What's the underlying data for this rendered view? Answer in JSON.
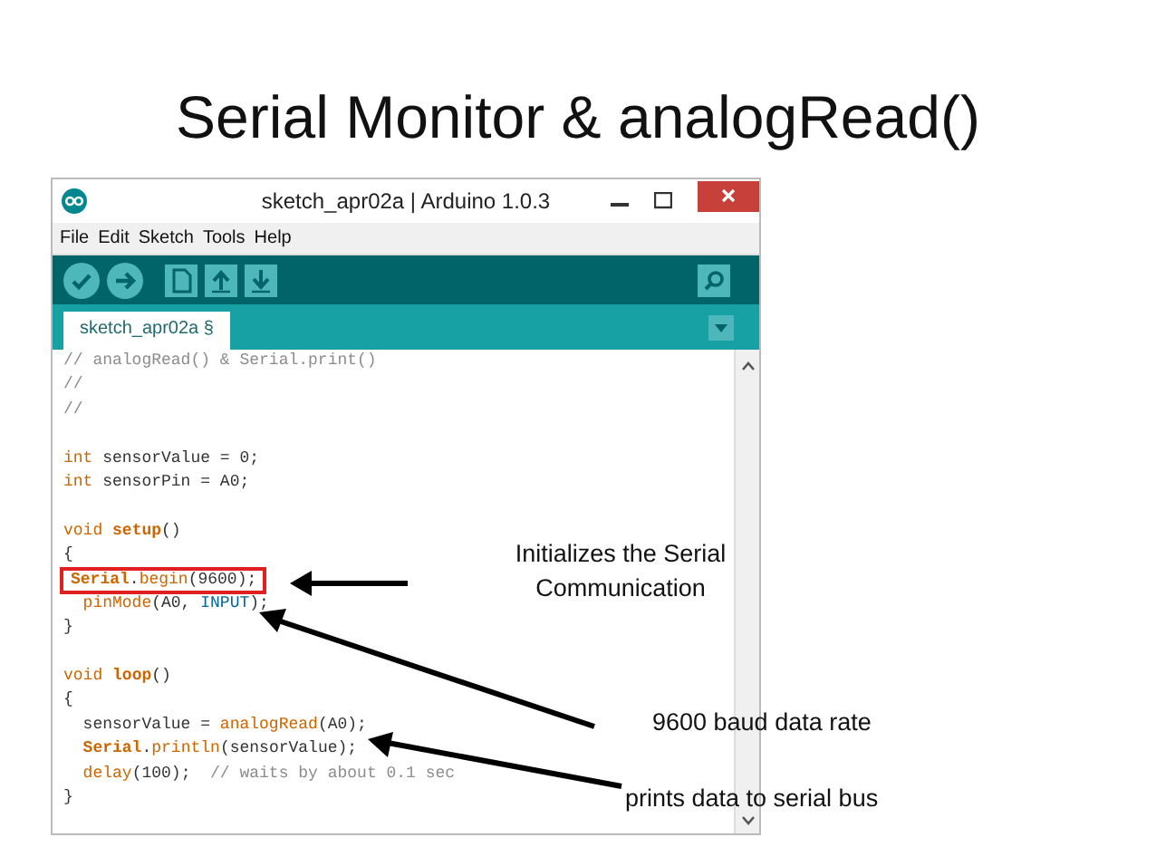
{
  "slide_title": "Serial Monitor & analogRead()",
  "window": {
    "title": "sketch_apr02a | Arduino 1.0.3",
    "menu": [
      "File",
      "Edit",
      "Sketch",
      "Tools",
      "Help"
    ],
    "tabs": [
      {
        "label": "sketch_apr02a §",
        "selected": true
      }
    ],
    "code_blocks": [
      [
        {
          "highlighted": false,
          "tokens": [
            {
              "text": "// analogRead() & Serial.print()",
              "kind": "comment"
            }
          ]
        },
        {
          "highlighted": false,
          "tokens": [
            {
              "text": "//",
              "kind": "comment"
            }
          ]
        },
        {
          "highlighted": false,
          "tokens": [
            {
              "text": "//",
              "kind": "comment"
            }
          ]
        }
      ],
      [
        {
          "highlighted": false,
          "tokens": [
            {
              "text": "int",
              "kind": "keyword"
            },
            {
              "text": " sensorValue = 0;",
              "kind": "plain"
            }
          ]
        },
        {
          "highlighted": false,
          "tokens": [
            {
              "text": "int",
              "kind": "keyword"
            },
            {
              "text": " sensorPin = A0;",
              "kind": "plain"
            }
          ]
        }
      ],
      [
        {
          "highlighted": false,
          "tokens": [
            {
              "text": "void ",
              "kind": "keyword"
            },
            {
              "text": "setup",
              "kind": "bold"
            },
            {
              "text": "()",
              "kind": "plain"
            }
          ]
        },
        {
          "highlighted": false,
          "tokens": [
            {
              "text": "{",
              "kind": "plain"
            }
          ]
        },
        {
          "highlighted": true,
          "tokens": [
            {
              "text": "Serial",
              "kind": "bold"
            },
            {
              "text": ".",
              "kind": "plain"
            },
            {
              "text": "begin",
              "kind": "keyword"
            },
            {
              "text": "(9600);",
              "kind": "plain"
            }
          ]
        },
        {
          "highlighted": false,
          "tokens": [
            {
              "text": "  pinMode",
              "kind": "keyword"
            },
            {
              "text": "(A0, ",
              "kind": "plain"
            },
            {
              "text": "INPUT",
              "kind": "constant"
            },
            {
              "text": ");",
              "kind": "plain"
            }
          ]
        },
        {
          "highlighted": false,
          "tokens": [
            {
              "text": "}",
              "kind": "plain"
            }
          ]
        }
      ],
      [
        {
          "highlighted": false,
          "tokens": [
            {
              "text": "void ",
              "kind": "keyword"
            },
            {
              "text": "loop",
              "kind": "bold"
            },
            {
              "text": "()",
              "kind": "plain"
            }
          ]
        },
        {
          "highlighted": false,
          "tokens": [
            {
              "text": "{",
              "kind": "plain"
            }
          ]
        },
        {
          "highlighted": false,
          "tokens": [
            {
              "text": "  sensorValue = ",
              "kind": "plain"
            },
            {
              "text": "analogRead",
              "kind": "keyword"
            },
            {
              "text": "(A0);",
              "kind": "plain"
            }
          ]
        },
        {
          "highlighted": false,
          "tokens": [
            {
              "text": "  Serial",
              "kind": "bold"
            },
            {
              "text": ".",
              "kind": "plain"
            },
            {
              "text": "println",
              "kind": "keyword"
            },
            {
              "text": "(sensorValue);",
              "kind": "plain"
            }
          ]
        },
        {
          "highlighted": false,
          "tokens": [
            {
              "text": "  delay",
              "kind": "keyword"
            },
            {
              "text": "(100);  ",
              "kind": "plain"
            },
            {
              "text": "// waits by about 0.1 sec",
              "kind": "comment"
            }
          ]
        },
        {
          "highlighted": false,
          "tokens": [
            {
              "text": "}",
              "kind": "plain"
            }
          ]
        }
      ]
    ]
  },
  "annotations": [
    {
      "text": "Initializes the Serial Communication"
    },
    {
      "text": "9600 baud data rate"
    },
    {
      "text": "prints data to serial bus"
    }
  ]
}
